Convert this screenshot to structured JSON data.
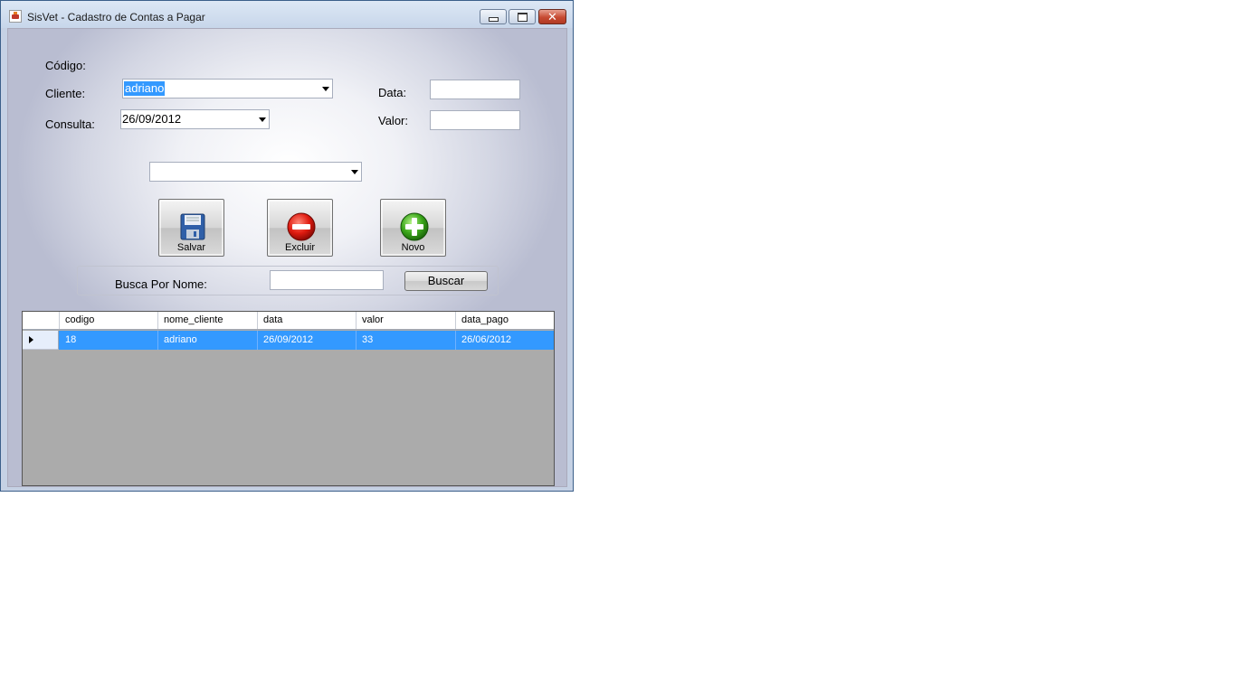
{
  "window": {
    "title": "SisVet - Cadastro de Contas a Pagar",
    "icon": "app-icon",
    "controls": {
      "minimize": "minimize-icon",
      "maximize": "maximize-icon",
      "close": "close-icon",
      "close_glyph": "✕"
    }
  },
  "form": {
    "codigo_label": "Código:",
    "cliente_label": "Cliente:",
    "cliente_value": "adriano",
    "consulta_label": "Consulta:",
    "consulta_value": "26/09/2012",
    "data_label": "Data:",
    "data_value": "",
    "valor_label": "Valor:",
    "valor_value": "",
    "extra_combo_value": ""
  },
  "actions": {
    "salvar": {
      "label": "Salvar",
      "icon": "floppy-disk-icon"
    },
    "excluir": {
      "label": "Excluir",
      "icon": "minus-circle-icon"
    },
    "novo": {
      "label": "Novo",
      "icon": "plus-circle-icon"
    }
  },
  "search": {
    "label": "Busca Por Nome:",
    "value": "",
    "button_label": "Buscar"
  },
  "table": {
    "columns": [
      "codigo",
      "nome_cliente",
      "data",
      "valor",
      "data_pago"
    ],
    "rows": [
      [
        "18",
        "adriano",
        "26/09/2012",
        "33",
        "26/06/2012"
      ]
    ],
    "selected_row_color": "#3399ff"
  }
}
